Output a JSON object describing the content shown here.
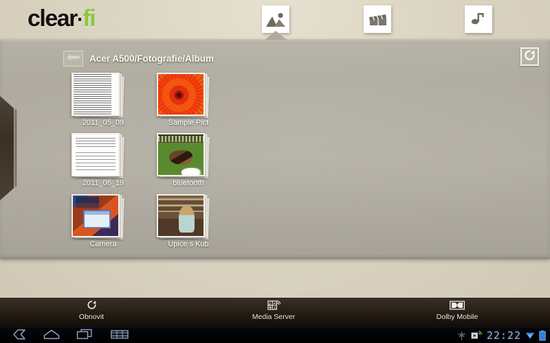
{
  "app": {
    "brand_part1": "clear",
    "brand_dot": "·",
    "brand_part2": "fi",
    "accent_color": "#8cc63e",
    "text_color": "#14110e"
  },
  "tabs": [
    {
      "id": "photo",
      "icon": "photo-icon",
      "label": "Photo",
      "active": true
    },
    {
      "id": "video",
      "icon": "video-clapperboard-icon",
      "label": "Video",
      "active": false
    },
    {
      "id": "music",
      "icon": "music-note-icon",
      "label": "Music",
      "active": false
    }
  ],
  "panel": {
    "back_icon": "back-arrow-icon",
    "breadcrumb": "Acer A500/Fotografie/Album",
    "refresh_icon": "refresh-icon"
  },
  "grid": {
    "items": [
      {
        "label": "2011_05_09",
        "art": "art-doc",
        "icon": "folder-thumbnail-document"
      },
      {
        "label": "Sample Pict",
        "art": "art-flower",
        "icon": "folder-thumbnail-flower"
      },
      {
        "label": "2011_06_19",
        "art": "art-doc2",
        "icon": "folder-thumbnail-document"
      },
      {
        "label": "bluetooth",
        "art": "art-dog",
        "icon": "folder-thumbnail-dog"
      },
      {
        "label": "Camera",
        "art": "art-desktop",
        "icon": "folder-thumbnail-desktop"
      },
      {
        "label": "Úpice s Kub",
        "art": "art-kid",
        "icon": "folder-thumbnail-portrait"
      }
    ]
  },
  "toolbar": {
    "refresh_label": "Obnovit",
    "refresh_icon": "refresh-icon",
    "media_server_label": "Media Server",
    "media_server_icon": "media-server-icon",
    "dolby_label": "Dolby Mobile",
    "dolby_icon": "dolby-icon"
  },
  "system_bar": {
    "back_icon": "android-back-icon",
    "home_icon": "android-home-icon",
    "recent_icon": "android-recent-apps-icon",
    "apps_icon": "android-apps-grid-icon",
    "usb_icon": "usb-debug-icon",
    "cast_icon": "media-cast-icon",
    "clock": "22:22",
    "wifi_icon": "wifi-icon",
    "battery_icon": "battery-icon"
  }
}
